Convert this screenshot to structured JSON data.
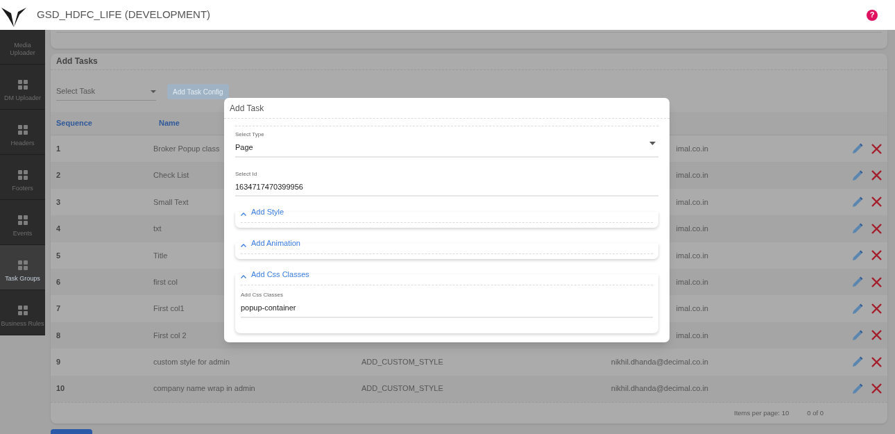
{
  "header": {
    "title": "GSD_HDFC_LIFE (DEVELOPMENT)",
    "help": "?"
  },
  "sidebar": {
    "items": [
      {
        "label": "Media Uploader",
        "selected": false
      },
      {
        "label": "DM Uploader",
        "selected": false
      },
      {
        "label": "Headers",
        "selected": false
      },
      {
        "label": "Footers",
        "selected": false
      },
      {
        "label": "Events",
        "selected": false
      },
      {
        "label": "Task Groups",
        "selected": true
      },
      {
        "label": "Business Rules",
        "selected": false
      }
    ]
  },
  "card": {
    "title": "Add Tasks",
    "select_placeholder": "Select Task",
    "config_button": {
      "label": "Add Task Config",
      "disabled": true
    }
  },
  "table": {
    "columns": [
      "Sequence",
      "Name"
    ],
    "rows": [
      {
        "sequence": "1",
        "name": "Broker Popup class",
        "email": "imal.co.in"
      },
      {
        "sequence": "2",
        "name": "Check List",
        "email": "imal.co.in"
      },
      {
        "sequence": "3",
        "name": "Small Text",
        "email": "imal.co.in"
      },
      {
        "sequence": "4",
        "name": "txt",
        "email": "imal.co.in"
      },
      {
        "sequence": "5",
        "name": "Title",
        "email": "imal.co.in"
      },
      {
        "sequence": "6",
        "name": "first col",
        "email": "imal.co.in"
      },
      {
        "sequence": "7",
        "name": "First col1",
        "email": "imal.co.in"
      },
      {
        "sequence": "8",
        "name": "First col 2",
        "email": "imal.co.in"
      },
      {
        "sequence": "9",
        "name": "custom style for admin",
        "type": "ADD_CUSTOM_STYLE",
        "email": "nikhil.dhanda@decimal.co.in"
      },
      {
        "sequence": "10",
        "name": "company name wrap in admin",
        "type": "ADD_CUSTOM_STYLE",
        "email": "nikhil.dhanda@decimal.co.in"
      }
    ],
    "pagination": {
      "items_per_page": "Items per page: 10",
      "range": "0 of 0"
    }
  },
  "dialog": {
    "title": "Add Task",
    "fields": [
      {
        "label": "Select Type",
        "value": "Page",
        "kind": "select"
      },
      {
        "label": "Select Id",
        "value": "1634717470399956",
        "kind": "text"
      }
    ],
    "sections": [
      {
        "title": "Add Style"
      },
      {
        "title": "Add Animation"
      },
      {
        "title": "Add Css Classes",
        "field": {
          "label": "Add Css Classes",
          "value": "popup-container"
        }
      }
    ]
  }
}
